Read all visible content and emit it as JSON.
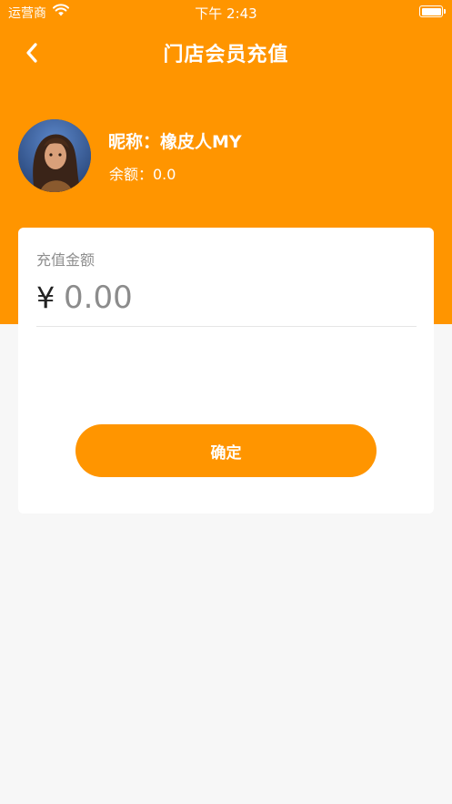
{
  "status_bar": {
    "carrier": "运营商",
    "time": "下午 2:43"
  },
  "nav": {
    "title": "门店会员充值",
    "back_icon": "chevron-left-icon"
  },
  "user": {
    "nickname": "昵称：橡皮人MY",
    "balance": "余额：0.0"
  },
  "recharge": {
    "label": "充值金额",
    "currency_symbol": "¥",
    "placeholder": "0.00",
    "value": ""
  },
  "confirm_label": "确定",
  "colors": {
    "accent": "#ff9500",
    "background": "#f7f7f7",
    "card": "#ffffff"
  }
}
